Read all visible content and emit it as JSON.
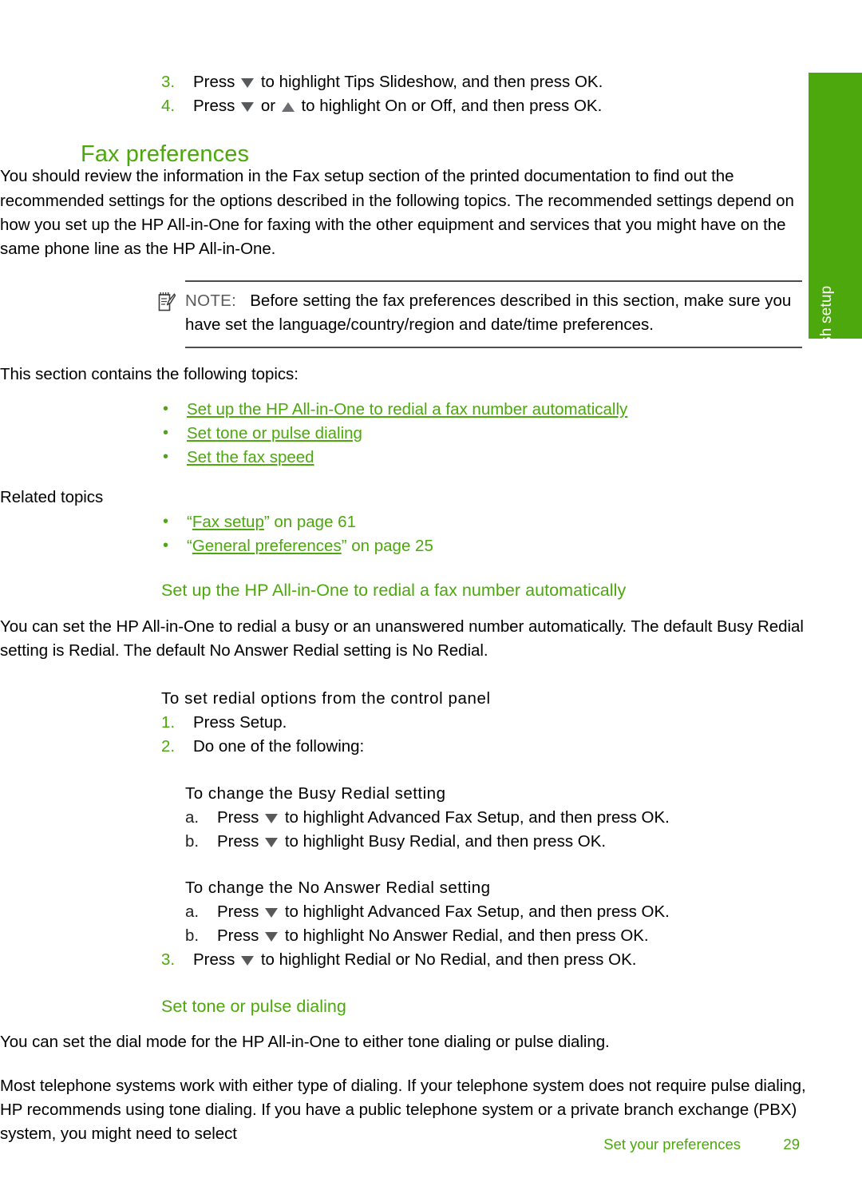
{
  "document": {
    "side_tab_label": "Finish setup",
    "accent_color": "#4ca80c",
    "text_color": "#231f20",
    "note_label_color": "#58595b"
  },
  "top_steps": {
    "items": [
      {
        "marker": "3.",
        "text_before": "Press",
        "icon1": "triangle-down-icon",
        "text_after": "to highlight Tips Slideshow, and then press OK."
      },
      {
        "marker": "4.",
        "text_before": "Press",
        "icon1": "triangle-down-icon",
        "text_middle": "or",
        "icon2": "triangle-up-icon",
        "text_after": "to highlight On or Off, and then press OK."
      }
    ]
  },
  "fax_preferences": {
    "heading": "Fax preferences",
    "intro": "You should review the information in the Fax setup section of the printed documentation to find out the recommended settings for the options described in the following topics. The recommended settings depend on how you set up the HP All-in-One for faxing with the other equipment and services that you might have on the same phone line as the HP All-in-One.",
    "note": {
      "icon": "note-pad-pencil-icon",
      "label": "NOTE:",
      "text": "Before setting the fax preferences described in this section, make sure you have set the language/country/region and date/time preferences."
    },
    "topics_intro": "This section contains the following topics:",
    "topics": [
      "Set up the HP All-in-One to redial a fax number automatically",
      "Set tone or pulse dialing",
      "Set the fax speed"
    ],
    "related_topics_label": "Related topics",
    "related_topics": [
      {
        "quote_open": "“",
        "title": "Fax setup",
        "quote_close": "”",
        "suffix": " on page 61"
      },
      {
        "quote_open": "“",
        "title": "General preferences",
        "quote_close": "”",
        "suffix": " on page 25"
      }
    ]
  },
  "redial_section": {
    "heading": "Set up the HP All-in-One to redial a fax number automatically",
    "intro": "You can set the HP All-in-One to redial a busy or an unanswered number automatically. The default Busy Redial setting is Redial. The default No Answer Redial setting is No Redial.",
    "procedure_title": "To set redial options from the control panel",
    "steps": [
      {
        "marker": "1.",
        "text": "Press Setup."
      },
      {
        "marker": "2.",
        "text": "Do one of the following:"
      }
    ],
    "busy_redial": {
      "title": "To change the Busy Redial setting",
      "steps": [
        {
          "marker": "a.",
          "text_before": "Press",
          "icon1": "triangle-down-icon",
          "text_after": "to highlight Advanced Fax Setup, and then press OK."
        },
        {
          "marker": "b.",
          "text_before": "Press",
          "icon1": "triangle-down-icon",
          "text_after": "to highlight Busy Redial, and then press OK."
        }
      ]
    },
    "no_answer_redial": {
      "title": "To change the No Answer Redial setting",
      "steps": [
        {
          "marker": "a.",
          "text_before": "Press",
          "icon1": "triangle-down-icon",
          "text_after": "to highlight Advanced Fax Setup, and then press OK."
        },
        {
          "marker": "b.",
          "text_before": "Press",
          "icon1": "triangle-down-icon",
          "text_after": "to highlight No Answer Redial, and then press OK."
        }
      ]
    },
    "final_step": {
      "marker": "3.",
      "text_before": "Press",
      "icon1": "triangle-down-icon",
      "text_after": "to highlight Redial or No Redial, and then press OK."
    }
  },
  "tone_pulse_section": {
    "heading": "Set tone or pulse dialing",
    "paragraph1": "You can set the dial mode for the HP All-in-One to either tone dialing or pulse dialing.",
    "paragraph2": "Most telephone systems work with either type of dialing. If your telephone system does not require pulse dialing, HP recommends using tone dialing. If you have a public telephone system or a private branch exchange (PBX) system, you might need to select"
  },
  "footer": {
    "title": "Set your preferences",
    "page_number": "29"
  }
}
